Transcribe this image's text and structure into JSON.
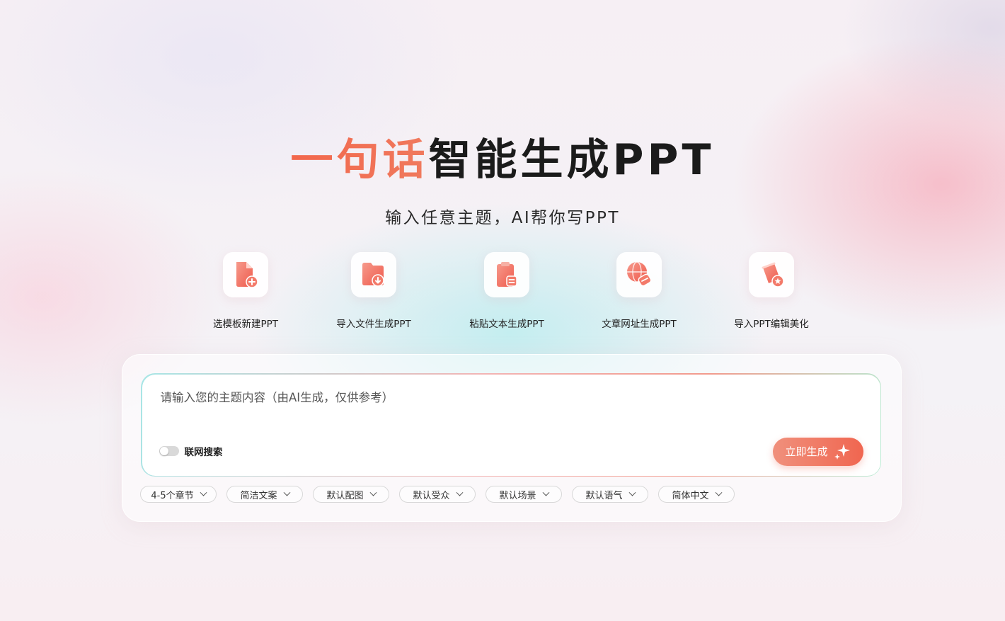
{
  "header": {
    "title_accent": "一句话",
    "title_rest": "智能生成PPT",
    "subtitle": "输入任意主题，AI帮你写PPT"
  },
  "features": [
    {
      "label": "选模板新建PPT",
      "icon": "new-document-icon"
    },
    {
      "label": "导入文件生成PPT",
      "icon": "import-file-icon"
    },
    {
      "label": "粘贴文本生成PPT",
      "icon": "clipboard-icon"
    },
    {
      "label": "文章网址生成PPT",
      "icon": "globe-link-icon"
    },
    {
      "label": "导入PPT编辑美化",
      "icon": "paint-bucket-icon"
    }
  ],
  "composer": {
    "placeholder": "请输入您的主题内容（由AI生成，仅供参考）",
    "value": "",
    "web_search_label": "联网搜索",
    "web_search_enabled": false,
    "generate_label": "立即生成"
  },
  "options": [
    {
      "label": "4-5个章节"
    },
    {
      "label": "简洁文案"
    },
    {
      "label": "默认配图"
    },
    {
      "label": "默认受众"
    },
    {
      "label": "默认场景"
    },
    {
      "label": "默认语气"
    },
    {
      "label": "简体中文"
    }
  ],
  "colors": {
    "accent": "#f2674c",
    "button_start": "#f0907c",
    "button_end": "#f06650"
  }
}
